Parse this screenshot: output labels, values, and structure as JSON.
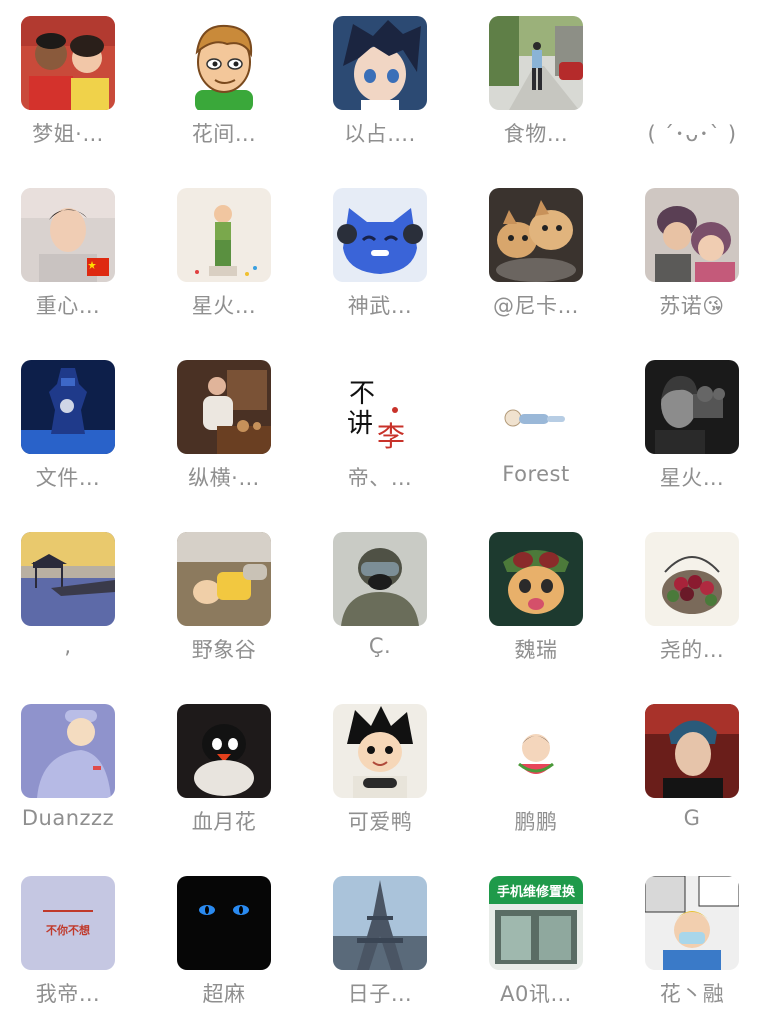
{
  "contacts": [
    {
      "name": "梦姐·…",
      "icon": "couple-selfie-photo"
    },
    {
      "name": "花间…",
      "icon": "cartoon-boy-avatar"
    },
    {
      "name": "以占….",
      "icon": "anime-boy-avatar"
    },
    {
      "name": "食物…",
      "icon": "street-walking-photo"
    },
    {
      "name": "( ´･ᴗ･` )",
      "icon": "none"
    },
    {
      "name": "重心…",
      "icon": "boy-selfie-with-flag"
    },
    {
      "name": "星火…",
      "icon": "toddler-standing-photo"
    },
    {
      "name": "神武…",
      "icon": "blue-cartoon-creature"
    },
    {
      "name": "@尼卡…",
      "icon": "kittens-photo"
    },
    {
      "name": "苏诺😘",
      "icon": "couple-hug-photo"
    },
    {
      "name": "文件…",
      "icon": "blue-robot-figure"
    },
    {
      "name": "纵横·…",
      "icon": "man-making-tea-photo"
    },
    {
      "name": "帝、…",
      "icon": "calligraphy-logo"
    },
    {
      "name": "Forest",
      "icon": "sleeping-baby-sketch"
    },
    {
      "name": "星火…",
      "icon": "man-with-camera-bw"
    },
    {
      "name": ",",
      "icon": "sunset-pier-photo"
    },
    {
      "name": "野象谷",
      "icon": "sleeping-child-photo"
    },
    {
      "name": "Ç.",
      "icon": "masked-ski-person"
    },
    {
      "name": "魏瑞",
      "icon": "teemo-game-character"
    },
    {
      "name": "尧的…",
      "icon": "grape-basket-painting"
    },
    {
      "name": "Duanzzz",
      "icon": "cartoon-character-purple"
    },
    {
      "name": "血月花",
      "icon": "penguin-plush"
    },
    {
      "name": "可爱鸭",
      "icon": "anime-boy-gaming"
    },
    {
      "name": "鹏鹏",
      "icon": "baby-eating-watermelon"
    },
    {
      "name": "G",
      "icon": "young-man-portrait"
    },
    {
      "name": "我帝…",
      "icon": "text-banner-avatar"
    },
    {
      "name": "超麻",
      "icon": "black-cat-blue-eyes"
    },
    {
      "name": "日子…",
      "icon": "eiffel-tower-photo"
    },
    {
      "name": "A0讯…",
      "icon": "phone-repair-storefront"
    },
    {
      "name": "花丶融",
      "icon": "comic-boy-collage"
    }
  ],
  "avatar_texts": {
    "calligraphy": "不讲李",
    "banner": "不你不想",
    "shop_sign": "手机维修置换"
  }
}
